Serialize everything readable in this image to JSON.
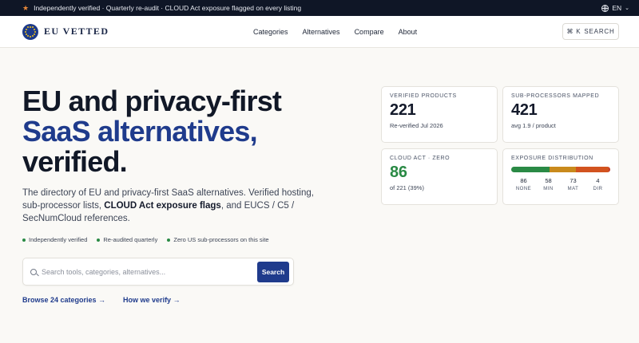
{
  "topbar": {
    "notice": "Independently verified · Quarterly re-audit · CLOUD Act exposure flagged on every listing",
    "lang": "EN"
  },
  "header": {
    "logo_text": "EU VETTED",
    "nav": [
      "Categories",
      "Alternatives",
      "Compare",
      "About"
    ],
    "search_shortcut": "⌘ K",
    "search_label": "SEARCH"
  },
  "hero": {
    "title_line1": "EU and privacy-first",
    "title_line2": "SaaS alternatives,",
    "title_line3": "verified.",
    "desc_part1": "The directory of EU and privacy-first SaaS alternatives. Verified hosting, sub-processor lists, ",
    "desc_bold": "CLOUD Act exposure flags",
    "desc_part2": ", and EUCS / C5 / SecNumCloud references.",
    "checks": [
      "Independently verified",
      "Re-audited quarterly",
      "Zero US sub-processors on this site"
    ],
    "search_placeholder": "Search tools, categories, alternatives...",
    "search_button": "Search",
    "link_categories": "Browse 24 categories →",
    "link_verify": "How we verify →"
  },
  "stats": {
    "verified": {
      "label": "VERIFIED PRODUCTS",
      "value": "221",
      "sub": "Re-verified Jul 2026"
    },
    "subprocessors": {
      "label": "SUB-PROCESSORS MAPPED",
      "value": "421",
      "sub": "avg 1.9 / product"
    },
    "cloudact": {
      "label": "CLOUD ACT · ZERO",
      "value": "86",
      "sub": "of 221 (39%)"
    },
    "exposure": {
      "label": "EXPOSURE DISTRIBUTION",
      "segments": [
        {
          "key": "NONE",
          "value": "86",
          "count": 86,
          "color": "#2a8a45"
        },
        {
          "key": "MIN",
          "value": "58",
          "count": 58,
          "color": "#c98a1c"
        },
        {
          "key": "MAT",
          "value": "73",
          "count": 73,
          "color": "#d2531f"
        },
        {
          "key": "DIR",
          "value": "4",
          "count": 4,
          "color": "#c0392b"
        }
      ]
    }
  },
  "colors": {
    "accent": "#1f3b8c",
    "green": "#2a8a45",
    "dark": "#0f1626"
  }
}
